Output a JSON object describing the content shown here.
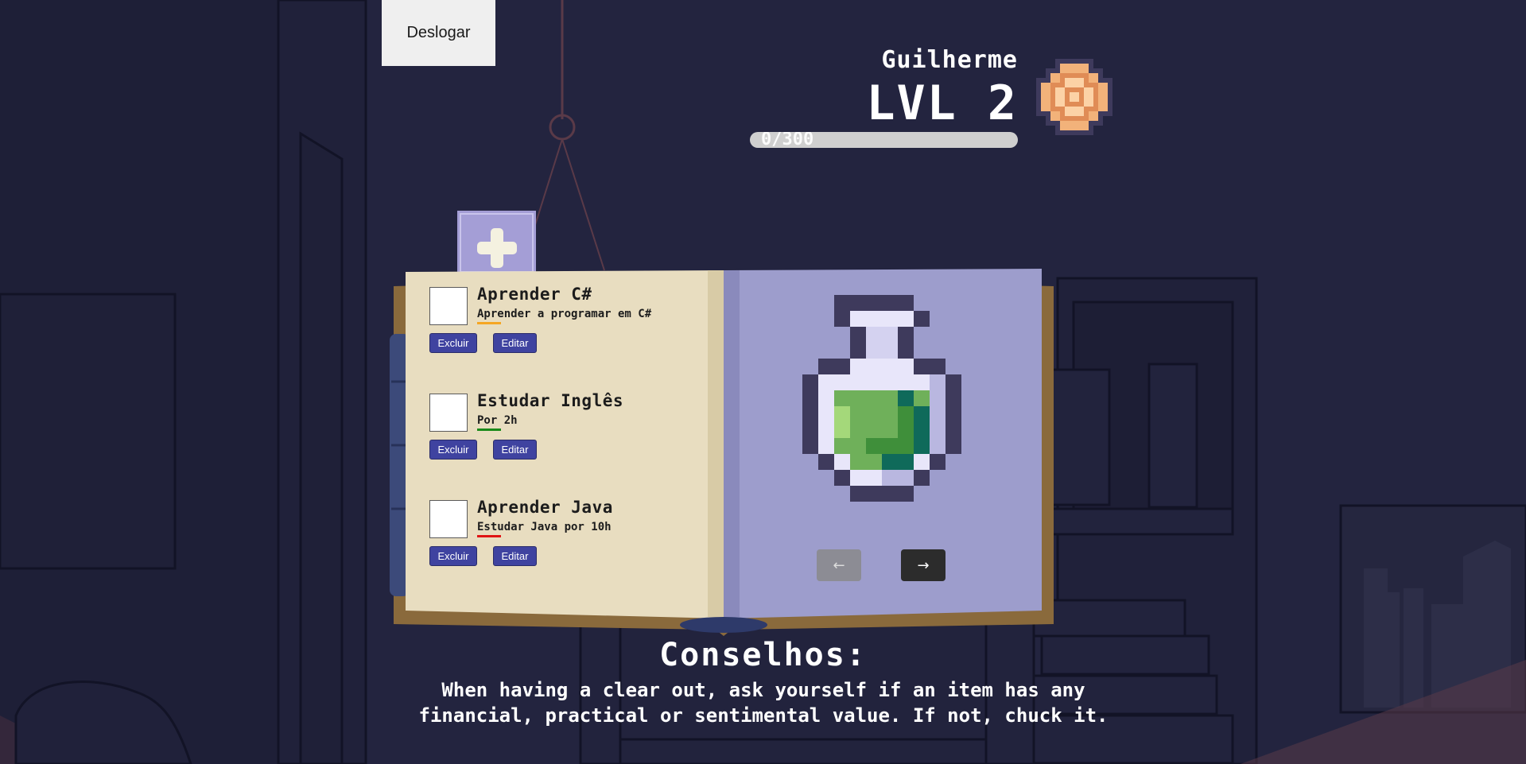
{
  "header": {
    "logout_label": "Deslogar"
  },
  "player": {
    "name": "Guilherme",
    "level_label": "LVL 2",
    "xp_text": "0/300",
    "xp_progress": 0,
    "medal_icon": "bronze-medal-icon"
  },
  "book": {
    "add_icon": "plus-icon",
    "tasks": [
      {
        "title": "Aprender C#",
        "description": "Aprender a programar em C#",
        "priority_color": "#f5a623",
        "delete_label": "Excluir",
        "edit_label": "Editar"
      },
      {
        "title": "Estudar Inglês",
        "description": "Por 2h",
        "priority_color": "#1a8a1a",
        "delete_label": "Excluir",
        "edit_label": "Editar"
      },
      {
        "title": "Aprender Java",
        "description": "Estudar Java por 10h",
        "priority_color": "#e01414",
        "delete_label": "Excluir",
        "edit_label": "Editar"
      }
    ],
    "reward_icon": "green-potion-icon",
    "prev_icon": "arrow-left-icon",
    "next_icon": "arrow-right-icon"
  },
  "tips": {
    "title": "Conselhos:",
    "text": "When having a clear out, ask yourself if an item has any financial, practical or sentimental value. If not, chuck it."
  },
  "colors": {
    "background": "#23243f",
    "button_primary": "#3f43a0",
    "page_left": "#e8ddc0",
    "page_right": "#9d9dcc"
  }
}
